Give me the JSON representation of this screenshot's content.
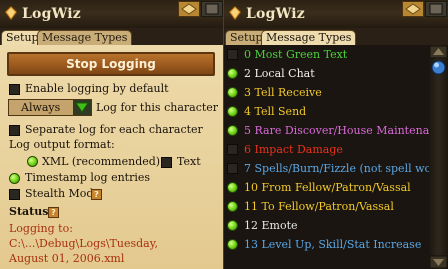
{
  "window_title": "LogWiz",
  "tabs": [
    {
      "label": "Setup"
    },
    {
      "label": "Message Types"
    }
  ],
  "setup": {
    "stop_button": "Stop Logging",
    "enable_by_default": "Enable logging by default",
    "dropdown_value": "Always",
    "log_for_character": "Log for this character",
    "separate_log": "Separate log for each character",
    "output_format_label": "Log output format:",
    "xml_option": "XML (recommended)",
    "text_option": "Text",
    "timestamp": "Timestamp log entries",
    "stealth": "Stealth Mode",
    "status_label": "Status",
    "help_glyph": "?",
    "status_line1": "Logging to: C:\\...\\Debug\\Logs\\Tuesday,",
    "status_line2": "August 01, 2006.xml"
  },
  "message_types": [
    {
      "num": "0",
      "label": "Most Green Text",
      "checked": false,
      "color": "#4bd13c"
    },
    {
      "num": "2",
      "label": "Local Chat",
      "checked": true,
      "color": "#f2f2f2"
    },
    {
      "num": "3",
      "label": "Tell Receive",
      "checked": true,
      "color": "#f2c92a"
    },
    {
      "num": "4",
      "label": "Tell Send",
      "checked": true,
      "color": "#f2c92a"
    },
    {
      "num": "5",
      "label": "Rare Discover/House Maintenance",
      "checked": true,
      "color": "#d86ad8"
    },
    {
      "num": "6",
      "label": "Impact Damage",
      "checked": false,
      "color": "#e8321c"
    },
    {
      "num": "7",
      "label": "Spells/Burn/Fizzle (not spell words)",
      "checked": false,
      "color": "#5aa7e6"
    },
    {
      "num": "10",
      "label": "From Fellow/Patron/Vassal",
      "checked": true,
      "color": "#f2c92a"
    },
    {
      "num": "11",
      "label": "To Fellow/Patron/Vassal",
      "checked": true,
      "color": "#f2c92a"
    },
    {
      "num": "12",
      "label": "Emote",
      "checked": true,
      "color": "#e8e8e8"
    },
    {
      "num": "13",
      "label": "Level Up, Skill/Stat Increase",
      "checked": true,
      "color": "#5aa7e6"
    }
  ],
  "colors": {
    "status_red": "#a8300f",
    "radio_green": "#7bdc1f",
    "panel_parchment": "#efdcae",
    "titlebar_dark": "#2b2114"
  }
}
